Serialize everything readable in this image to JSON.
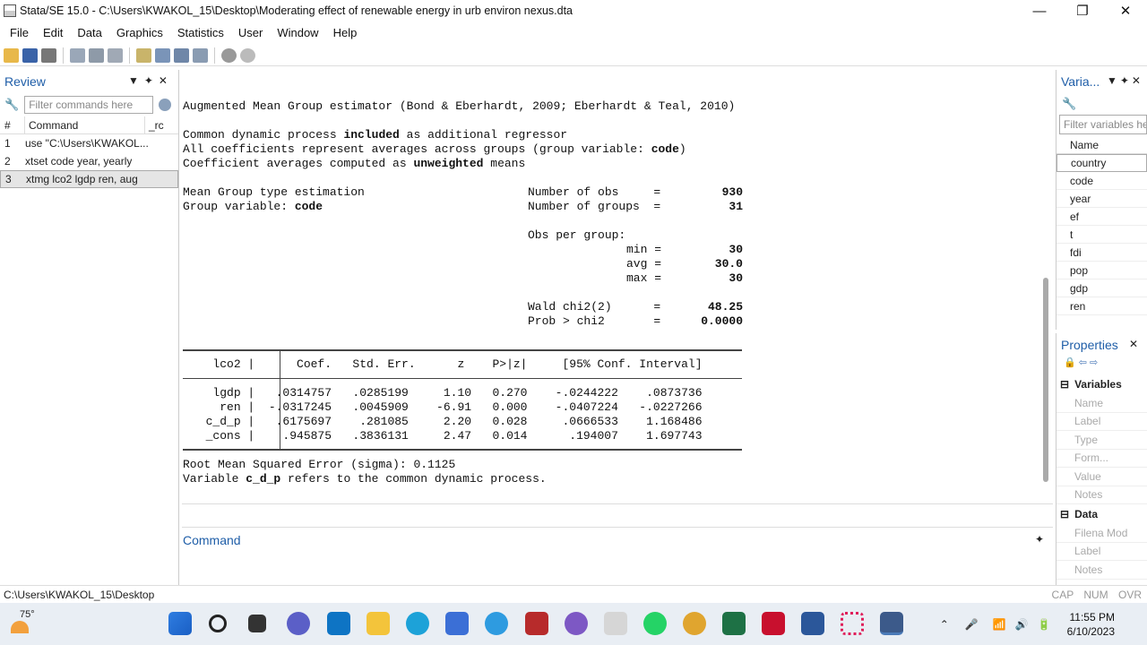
{
  "window": {
    "title": "Stata/SE 15.0 - C:\\Users\\KWAKOL_15\\Desktop\\Moderating effect of renewable energy in urb environ nexus.dta",
    "min": "—",
    "max": "❐",
    "close": "✕"
  },
  "menu": [
    "File",
    "Edit",
    "Data",
    "Graphics",
    "Statistics",
    "User",
    "Window",
    "Help"
  ],
  "review": {
    "title": "Review",
    "filter_placeholder": "Filter commands here",
    "col_num": "#",
    "col_cmd": "Command",
    "col_rc": "_rc",
    "items": [
      {
        "n": "1",
        "cmd": "use \"C:\\Users\\KWAKOL..."
      },
      {
        "n": "2",
        "cmd": "xtset code year, yearly"
      },
      {
        "n": "3",
        "cmd": "xtmg lco2 lgdp ren, aug"
      }
    ]
  },
  "results": {
    "heading": "Augmented Mean Group estimator (Bond & Eberhardt, 2009; Eberhardt & Teal, 2010)",
    "l1a": "Common dynamic process ",
    "l1b": "included",
    "l1c": " as additional regressor",
    "l2a": "All coefficients represent averages across groups (group variable: ",
    "l2b": "code",
    "l2c": ")",
    "l3a": "Coefficient averages computed as ",
    "l3b": "unweighted",
    "l3c": " means",
    "est_type": "Mean Group type estimation",
    "group_var_label": "Group variable: ",
    "group_var": "code",
    "nobs_label": "Number of obs     =",
    "nobs": "930",
    "ngroups_label": "Number of groups  =",
    "ngroups": "31",
    "obs_per_group": "Obs per group:",
    "min_label": "min =",
    "min": "30",
    "avg_label": "avg =",
    "avg": "30.0",
    "max_label": "max =",
    "max": "30",
    "wald_label": "Wald chi2(2)      =",
    "wald": "48.25",
    "prob_label": "Prob > chi2       =",
    "prob": "0.0000",
    "table_header": "        lco2 |      Coef.   Std. Err.      z    P>|z|     [95% Conf. Interval]",
    "rows": [
      "        lgdp |   .0314757   .0285199     1.10   0.270    -.0244222    .0873736",
      "         ren |  -.0317245   .0045909    -6.91   0.000    -.0407224   -.0227266",
      "       c_d_p |   .6175697    .281085     2.20   0.028     .0666533    1.168486",
      "       _cons |    .945875   .3836131     2.47   0.014      .194007    1.697743"
    ],
    "rmse": "Root Mean Squared Error (sigma): 0.1125",
    "foot_a": "Variable ",
    "foot_b": "c_d_p",
    "foot_c": " refers to the common dynamic process."
  },
  "command_panel": {
    "title": "Command"
  },
  "variables": {
    "title": "Varia...",
    "filter_placeholder": "Filter variables he",
    "col_name": "Name",
    "items": [
      "country",
      "code",
      "year",
      "ef",
      "t",
      "fdi",
      "pop",
      "gdp",
      "ren"
    ]
  },
  "properties": {
    "title": "Properties",
    "sec_variables": "Variables",
    "var_rows": [
      "Name",
      "Label",
      "Type",
      "Form...",
      "Value",
      "Notes"
    ],
    "sec_data": "Data",
    "data_rows": [
      "Filena Mod",
      "Label",
      "Notes"
    ]
  },
  "statusbar": {
    "path": "C:\\Users\\KWAKOL_15\\Desktop",
    "indicators": "CAP NUM OVR"
  },
  "taskbar": {
    "temp": "75°",
    "time": "11:55 PM",
    "date": "6/10/2023"
  }
}
